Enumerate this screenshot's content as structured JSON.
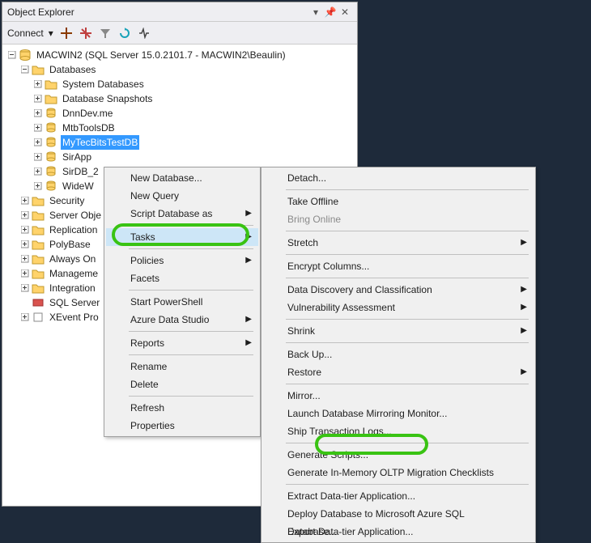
{
  "panel": {
    "title": "Object Explorer",
    "connect": "Connect"
  },
  "tree": {
    "server": "MACWIN2 (SQL Server 15.0.2101.7 - MACWIN2\\Beaulin)",
    "databases": "Databases",
    "system_databases": "System Databases",
    "database_snapshots": "Database Snapshots",
    "db1": "DnnDev.me",
    "db2": "MtbToolsDB",
    "db3": "MyTecBitsTestDB",
    "db4": "SirApp",
    "db5": "SirDB_2",
    "db6": "WideW",
    "security": "Security",
    "server_obj": "Server Obje",
    "replication": "Replication",
    "polybase": "PolyBase",
    "always_on": "Always On",
    "management": "Manageme",
    "integration": "Integration",
    "sql_server": "SQL Server",
    "xevent": "XEvent Pro"
  },
  "menu1": {
    "new_database": "New Database...",
    "new_query": "New Query",
    "script_db": "Script Database as",
    "tasks": "Tasks",
    "policies": "Policies",
    "facets": "Facets",
    "start_ps": "Start PowerShell",
    "azure_ds": "Azure Data Studio",
    "reports": "Reports",
    "rename": "Rename",
    "delete": "Delete",
    "refresh": "Refresh",
    "properties": "Properties"
  },
  "menu2": {
    "detach": "Detach...",
    "take_offline": "Take Offline",
    "bring_online": "Bring Online",
    "stretch": "Stretch",
    "encrypt": "Encrypt Columns...",
    "ddc": "Data Discovery and Classification",
    "vuln": "Vulnerability Assessment",
    "shrink": "Shrink",
    "backup": "Back Up...",
    "restore": "Restore",
    "mirror": "Mirror...",
    "mirror_monitor": "Launch Database Mirroring Monitor...",
    "ship_logs": "Ship Transaction Logs...",
    "gen_scripts": "Generate Scripts...",
    "gen_inmem": "Generate In-Memory OLTP Migration Checklists",
    "extract_dac": "Extract Data-tier Application...",
    "deploy_azure": "Deploy Database to Microsoft Azure SQL Database...",
    "export_dac": "Export Data-tier Application..."
  }
}
